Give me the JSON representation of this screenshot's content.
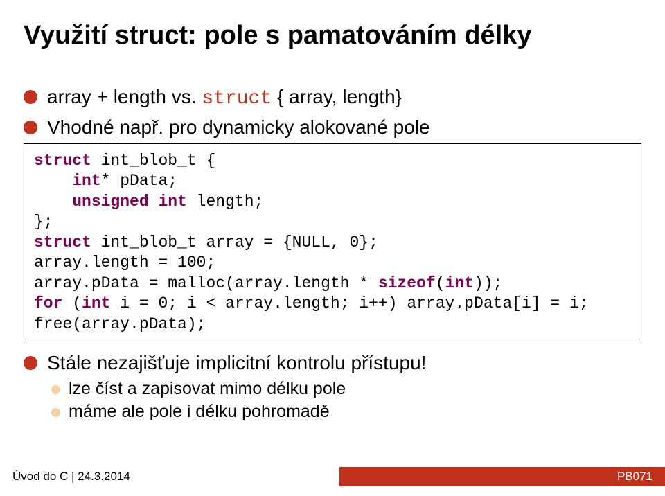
{
  "title": "Využití struct: pole s pamatováním délky",
  "b1": {
    "t1a": "array + length vs. ",
    "t1b": "struct",
    "t1c": " { array, length}",
    "t2": "Vhodné např. pro dynamicky alokované pole",
    "t3": "Stále nezajišťuje implicitní kontrolu přístupu!"
  },
  "code": {
    "l1a": "struct",
    "l1b": " int_blob_t {",
    "l2a": "    ",
    "l2b": "int",
    "l2c": "* pData;",
    "l3a": "    ",
    "l3b": "unsigned",
    "l3c": " ",
    "l3d": "int",
    "l3e": " length;",
    "l4": "};",
    "l5a": "struct",
    "l5b": " int_blob_t array = {NULL, 0};",
    "l6": "array.length = 100;",
    "l7a": "array.pData = malloc(array.length * ",
    "l7b": "sizeof",
    "l7c": "(",
    "l7d": "int",
    "l7e": "));",
    "l8a": "for",
    "l8b": " (",
    "l8c": "int",
    "l8d": " i = 0; i < array.length; i++) array.pData[i] = i;",
    "l9": "free(array.pData);"
  },
  "b2": {
    "s1": "lze číst a zapisovat mimo délku pole",
    "s2": "máme ale pole i délku pohromadě"
  },
  "footer": {
    "left": "Úvod do C | 24.3.2014",
    "right": "PB071"
  }
}
